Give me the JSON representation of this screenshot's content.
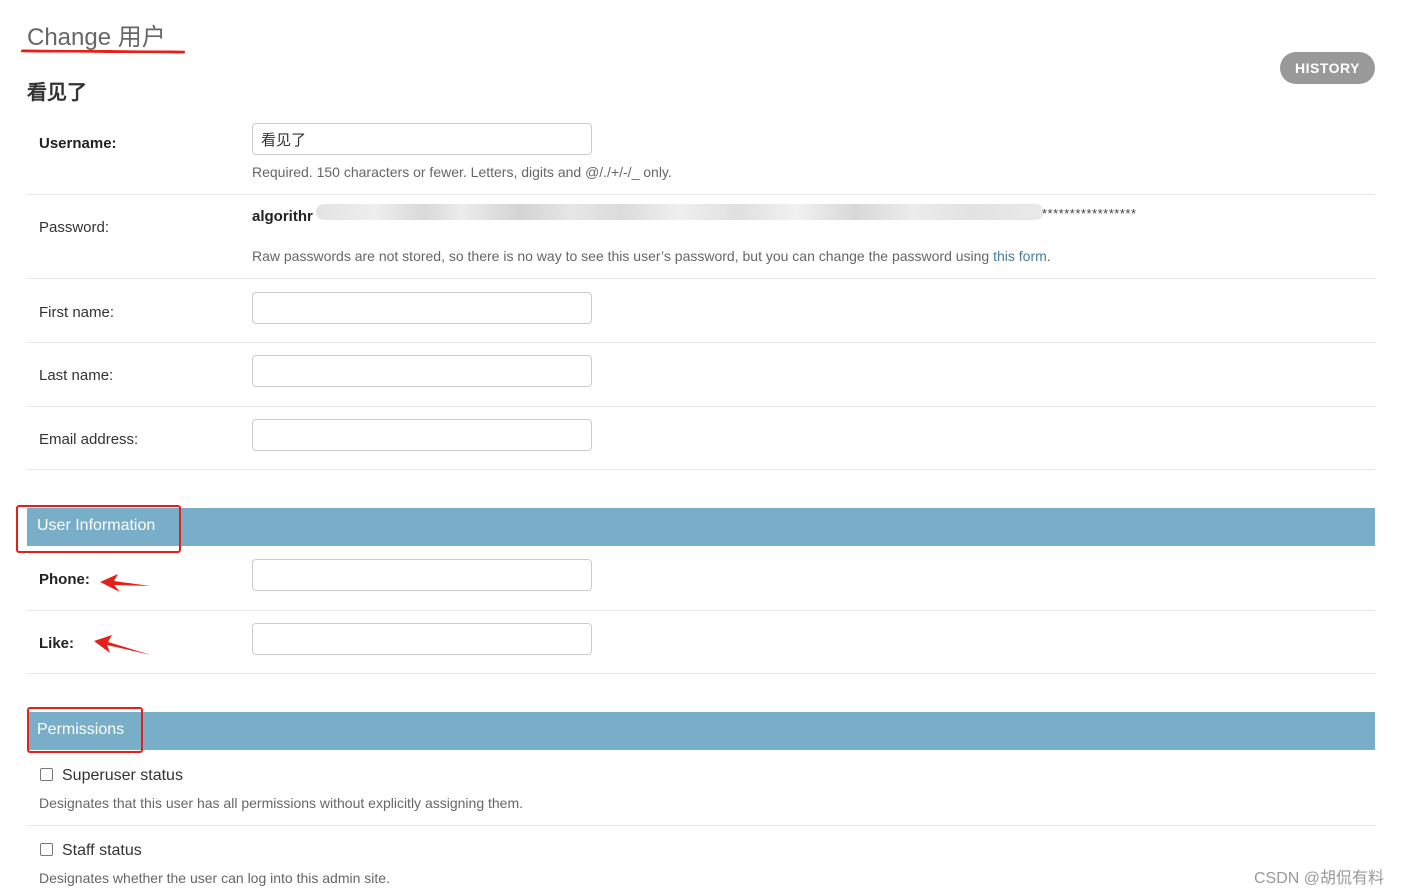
{
  "header": {
    "title": "Change 用户",
    "history_label": "HISTORY",
    "object_name": "看见了"
  },
  "fields": {
    "username": {
      "label": "Username:",
      "value": "看见了",
      "help": "Required. 150 characters or fewer. Letters, digits and @/./+/-/_ only."
    },
    "password": {
      "label": "Password:",
      "value_prefix": "algorithr",
      "value_suffix": "*****************",
      "help_text": "Raw passwords are not stored, so there is no way to see this user’s password, but you can change the password using ",
      "help_link": "this form",
      "help_end": "."
    },
    "first_name": {
      "label": "First name:",
      "value": ""
    },
    "last_name": {
      "label": "Last name:",
      "value": ""
    },
    "email": {
      "label": "Email address:",
      "value": ""
    }
  },
  "user_information": {
    "title": "User Information",
    "phone_label": "Phone:",
    "phone_value": "",
    "like_label": "Like:",
    "like_value": ""
  },
  "permissions": {
    "title": "Permissions",
    "superuser_label": "Superuser status",
    "superuser_help": "Designates that this user has all permissions without explicitly assigning them.",
    "superuser_checked": false,
    "staff_label": "Staff status",
    "staff_help": "Designates whether the user can log into this admin site.",
    "staff_checked": false
  },
  "annotation_color": "#e4201a",
  "module_color": "#79aec8",
  "watermark": "CSDN @胡侃有料"
}
